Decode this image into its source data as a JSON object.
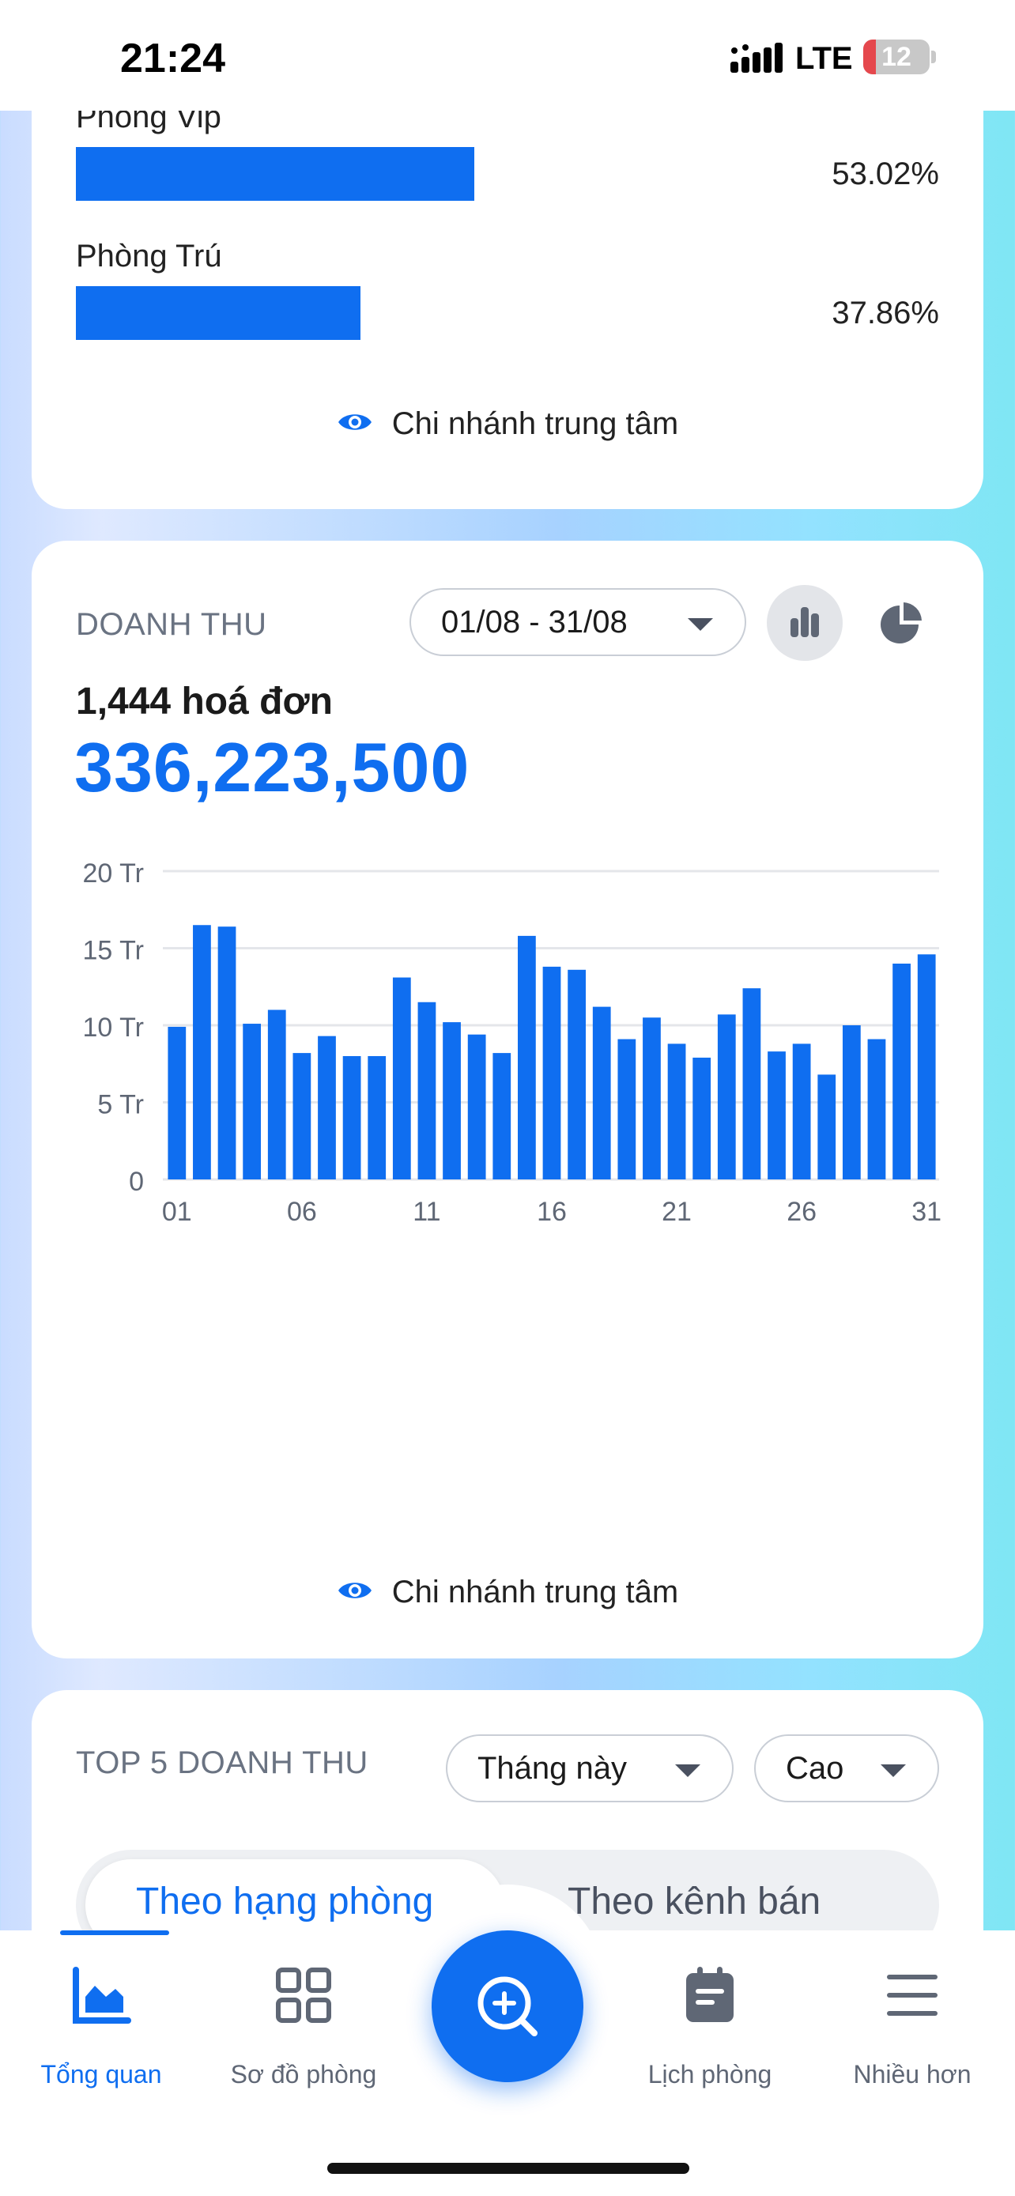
{
  "status_bar": {
    "time": "21:24",
    "network": "LTE",
    "battery": "12"
  },
  "room_ratio": {
    "items": [
      {
        "label": "Phòng Vip",
        "percent": "53.02%",
        "value": 53.02
      },
      {
        "label": "Phòng Trú",
        "percent": "37.86%",
        "value": 37.86
      }
    ],
    "branch": "Chi nhánh trung tâm"
  },
  "revenue": {
    "title": "DOANH THU",
    "date_range": "01/08 - 31/08",
    "invoices": "1,444 hoá đơn",
    "total": "336,223,500",
    "branch": "Chi nhánh trung tâm"
  },
  "chart_data": {
    "type": "bar",
    "categories": [
      "01",
      "02",
      "03",
      "04",
      "05",
      "06",
      "07",
      "08",
      "09",
      "10",
      "11",
      "12",
      "13",
      "14",
      "15",
      "16",
      "17",
      "18",
      "19",
      "20",
      "21",
      "22",
      "23",
      "24",
      "25",
      "26",
      "27",
      "28",
      "29",
      "30",
      "31"
    ],
    "values": [
      9.9,
      16.5,
      16.4,
      10.1,
      11.0,
      8.2,
      9.3,
      8.0,
      8.0,
      13.1,
      11.5,
      10.2,
      9.4,
      8.2,
      15.8,
      13.8,
      13.6,
      11.2,
      9.1,
      10.5,
      8.8,
      7.9,
      10.7,
      12.4,
      8.3,
      8.8,
      6.8,
      10.0,
      9.1,
      14.0,
      14.6
    ],
    "xticks": [
      "01",
      "06",
      "11",
      "16",
      "21",
      "26",
      "31"
    ],
    "yticks": [
      "0",
      "5 Tr",
      "10 Tr",
      "15 Tr",
      "20 Tr"
    ],
    "ylim": [
      0,
      20
    ],
    "grid": true,
    "color": "#0f6ef0"
  },
  "top5": {
    "title": "TOP 5 DOANH THU",
    "period": "Tháng này",
    "order": "Cao",
    "tabs": [
      "Theo hạng phòng",
      "Theo kênh bán"
    ]
  },
  "bottom_nav": {
    "items": [
      {
        "label": "Tổng quan",
        "icon": "area-chart-icon"
      },
      {
        "label": "Sơ đồ phòng",
        "icon": "grid-icon"
      },
      {
        "label": "Lịch phòng",
        "icon": "calendar-icon"
      },
      {
        "label": "Nhiều hơn",
        "icon": "menu-icon"
      }
    ],
    "fab_icon": "search-plus-icon"
  },
  "colors": {
    "accent": "#0f6ef0",
    "muted": "#6a7382"
  }
}
